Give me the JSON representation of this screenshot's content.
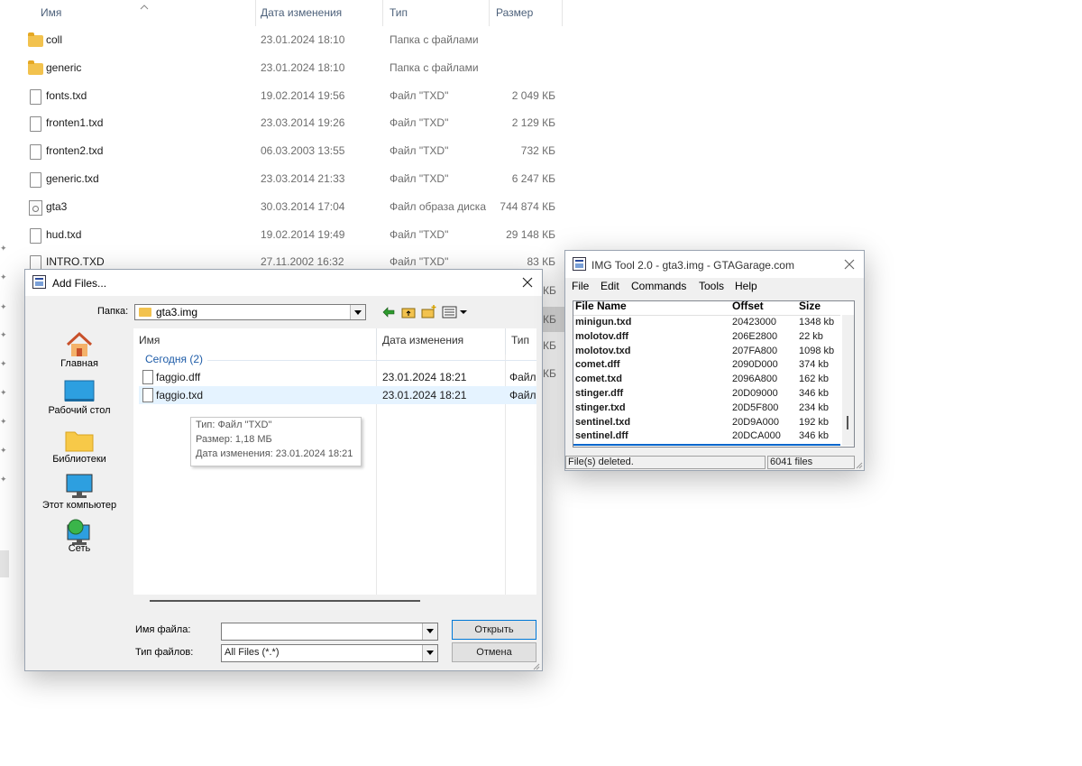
{
  "explorer": {
    "columns": {
      "name": "Имя",
      "date": "Дата изменения",
      "type": "Тип",
      "size": "Размер"
    },
    "files": [
      {
        "name": "coll",
        "date": "23.01.2024 18:10",
        "type": "Папка с файлами",
        "size": "",
        "kind": "folder"
      },
      {
        "name": "generic",
        "date": "23.01.2024 18:10",
        "type": "Папка с файлами",
        "size": "",
        "kind": "folder"
      },
      {
        "name": "fonts.txd",
        "date": "19.02.2014 19:56",
        "type": "Файл \"TXD\"",
        "size": "2 049 КБ",
        "kind": "file"
      },
      {
        "name": "fronten1.txd",
        "date": "23.03.2014 19:26",
        "type": "Файл \"TXD\"",
        "size": "2 129 КБ",
        "kind": "file"
      },
      {
        "name": "fronten2.txd",
        "date": "06.03.2003 13:55",
        "type": "Файл \"TXD\"",
        "size": "732 КБ",
        "kind": "file"
      },
      {
        "name": "generic.txd",
        "date": "23.03.2014 21:33",
        "type": "Файл \"TXD\"",
        "size": "6 247 КБ",
        "kind": "file"
      },
      {
        "name": "gta3",
        "date": "30.03.2014 17:04",
        "type": "Файл образа диска",
        "size": "744 874 КБ",
        "kind": "disc"
      },
      {
        "name": "hud.txd",
        "date": "19.02.2014 19:49",
        "type": "Файл \"TXD\"",
        "size": "29 148 КБ",
        "kind": "file"
      },
      {
        "name": "INTRO.TXD",
        "date": "27.11.2002 16:32",
        "type": "Файл \"TXD\"",
        "size": "83 КБ",
        "kind": "file"
      }
    ],
    "partial_sizes": [
      "КБ",
      "КБ",
      "КБ",
      "КБ"
    ]
  },
  "add_files": {
    "title": "Add Files...",
    "folder_label": "Папка:",
    "folder_value": "gta3.img",
    "places": [
      "Главная",
      "Рабочий стол",
      "Библиотеки",
      "Этот компьютер",
      "Сеть"
    ],
    "columns": {
      "name": "Имя",
      "date": "Дата изменения",
      "type": "Тип"
    },
    "group_label": "Сегодня (2)",
    "files": [
      {
        "name": "faggio.dff",
        "date": "23.01.2024 18:21",
        "type": "Файл"
      },
      {
        "name": "faggio.txd",
        "date": "23.01.2024 18:21",
        "type": "Файл"
      }
    ],
    "tooltip": {
      "type": "Тип: Файл \"TXD\"",
      "size": "Размер: 1,18 МБ",
      "date": "Дата изменения: 23.01.2024 18:21"
    },
    "filename_label": "Имя файла:",
    "filename_value": "",
    "filetype_label": "Тип файлов:",
    "filetype_value": "All Files (*.*)",
    "open_button": "Открыть",
    "cancel_button": "Отмена"
  },
  "img_tool": {
    "title": "IMG Tool 2.0 - gta3.img - GTAGarage.com",
    "menu": [
      "File",
      "Edit",
      "Commands",
      "Tools",
      "Help"
    ],
    "columns": {
      "name": "File Name",
      "offset": "Offset",
      "size": "Size"
    },
    "rows": [
      {
        "name": "minigun.txd",
        "offset": "20423000",
        "size": "1348 kb"
      },
      {
        "name": "molotov.dff",
        "offset": "206E2800",
        "size": "22 kb"
      },
      {
        "name": "molotov.txd",
        "offset": "207FA800",
        "size": "1098 kb"
      },
      {
        "name": "comet.dff",
        "offset": "2090D000",
        "size": "374 kb"
      },
      {
        "name": "comet.txd",
        "offset": "2096A800",
        "size": "162 kb"
      },
      {
        "name": "stinger.dff",
        "offset": "20D09000",
        "size": "346 kb"
      },
      {
        "name": "stinger.txd",
        "offset": "20D5F800",
        "size": "234 kb"
      },
      {
        "name": "sentinel.txd",
        "offset": "20D9A000",
        "size": "192 kb"
      },
      {
        "name": "sentinel.dff",
        "offset": "20DCA000",
        "size": "346 kb"
      }
    ],
    "status_left": "File(s) deleted.",
    "status_right": "6041 files"
  },
  "colors": {
    "accent": "#0066cc",
    "folder": "#f2c24e",
    "selection": "#e5f3ff",
    "group": "#1e5ca8"
  }
}
